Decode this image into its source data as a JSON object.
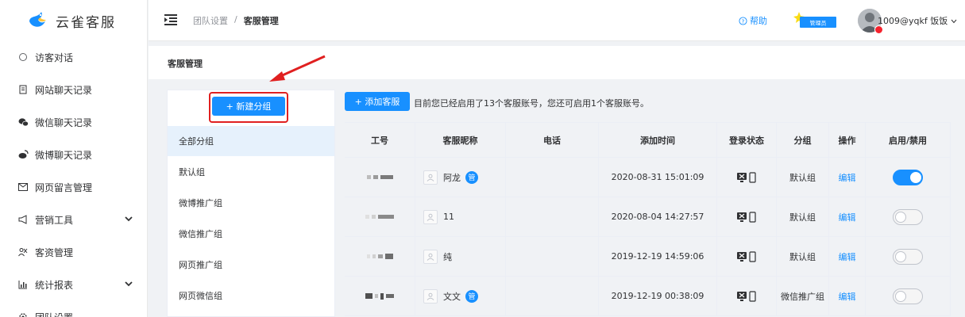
{
  "brand": {
    "name": "云雀客服"
  },
  "sidebar": {
    "items": [
      {
        "label": "访客对话",
        "icon": "chat-bubble-icon"
      },
      {
        "label": "网站聊天记录",
        "icon": "document-icon"
      },
      {
        "label": "微信聊天记录",
        "icon": "wechat-icon"
      },
      {
        "label": "微博聊天记录",
        "icon": "weibo-icon"
      },
      {
        "label": "网页留言管理",
        "icon": "mail-icon"
      },
      {
        "label": "营销工具",
        "icon": "megaphone-icon",
        "expandable": true
      },
      {
        "label": "客资管理",
        "icon": "users-icon"
      },
      {
        "label": "统计报表",
        "icon": "bar-chart-icon",
        "expandable": true
      },
      {
        "label": "团队设置",
        "icon": "gear-icon"
      }
    ]
  },
  "header": {
    "breadcrumb": [
      "团队设置",
      "/",
      "客服管理"
    ],
    "help": "帮助",
    "admin_badge": "管理员",
    "user": "1009@yqkf 饭饭"
  },
  "page": {
    "title": "客服管理"
  },
  "groups": {
    "new_button": "+ 新建分组",
    "items": [
      "全部分组",
      "默认组",
      "微博推广组",
      "微信推广组",
      "网页推广组",
      "网页微信组"
    ],
    "active_index": 0
  },
  "agents": {
    "add_button": "+ 添加客服",
    "notice": "目前您已经启用了13个客服账号，您还可启用1个客服账号。",
    "columns": [
      "工号",
      "客服昵称",
      "电话",
      "添加时间",
      "登录状态",
      "分组",
      "操作",
      "启用/禁用"
    ],
    "rows": [
      {
        "nickname": "阿龙",
        "manager": true,
        "manager_badge": "管",
        "phone": "",
        "added": "2020-08-31 15:01:09",
        "group": "默认组",
        "action": "编辑",
        "enabled": true
      },
      {
        "nickname": "11",
        "manager": false,
        "manager_badge": "",
        "phone": "",
        "added": "2020-08-04 14:27:57",
        "group": "默认组",
        "action": "编辑",
        "enabled": false
      },
      {
        "nickname": "纯",
        "manager": false,
        "manager_badge": "",
        "phone": "",
        "added": "2019-12-19 14:59:06",
        "group": "默认组",
        "action": "编辑",
        "enabled": false
      },
      {
        "nickname": "文文",
        "manager": true,
        "manager_badge": "管",
        "phone": "",
        "added": "2019-12-19 00:38:09",
        "group": "微信推广组",
        "action": "编辑",
        "enabled": false
      }
    ]
  },
  "colors": {
    "primary": "#1890ff",
    "highlight": "#e02020",
    "active_bg": "#e6f1fc"
  }
}
